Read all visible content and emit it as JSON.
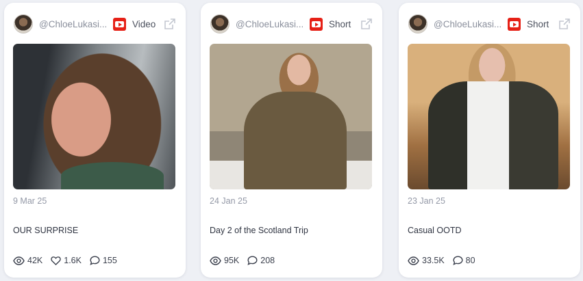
{
  "cards": [
    {
      "handle": "@ChloeLukasi...",
      "type": "Video",
      "date": "9 Mar 25",
      "title": "OUR SURPRISE",
      "views": "42K",
      "likes": "1.6K",
      "comments": "155"
    },
    {
      "handle": "@ChloeLukasi...",
      "type": "Short",
      "date": "24 Jan 25",
      "title": "Day 2 of the Scotland Trip",
      "views": "95K",
      "comments": "208"
    },
    {
      "handle": "@ChloeLukasi...",
      "type": "Short",
      "date": "23 Jan 25",
      "title": "Casual OOTD",
      "views": "33.5K",
      "comments": "80"
    }
  ],
  "icons": {
    "platform": "youtube-icon",
    "external": "external-link-icon",
    "views": "eye-icon",
    "likes": "heart-icon",
    "comments": "comment-icon"
  },
  "colors": {
    "youtube_red": "#e62117",
    "muted_text": "#8a8f9c"
  }
}
